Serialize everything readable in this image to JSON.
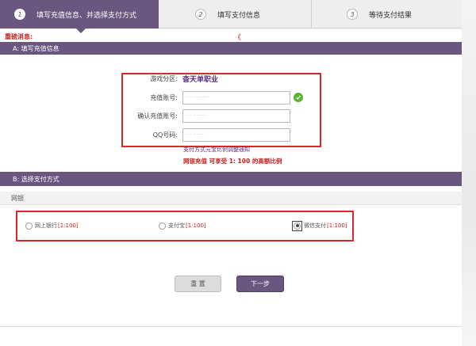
{
  "steps": [
    {
      "num": "1",
      "label": "填写充值信息、并选择支付方式"
    },
    {
      "num": "2",
      "label": "填写支付信息"
    },
    {
      "num": "3",
      "label": "等待支付结果"
    }
  ],
  "notice": {
    "label": "重磅消息:",
    "mark": "《"
  },
  "section_a": {
    "title": "A: 填写充值信息"
  },
  "form": {
    "server_label": "游戏分区:",
    "server_value": "杳天单职业",
    "account_label": "充值账号:",
    "account_value": "· ··· ·········",
    "confirm_label": "确认充值账号:",
    "confirm_value": "·  ··  ·········",
    "qq_label": "QQ号码:",
    "qq_value": "·  ··  ·······"
  },
  "hint": "支付方式元宝比例调整通知",
  "rate_note": "网银充值  可享受  1: 100  的高额比例",
  "section_b": {
    "title": "B: 选择支付方式"
  },
  "bank_strip": "网银",
  "payment_options": [
    {
      "name": "网上银行",
      "rate": "[1:100]"
    },
    {
      "name": "支付宝",
      "rate": "[1:100]"
    },
    {
      "name": "微信支付",
      "rate": "[1:100]"
    }
  ],
  "buttons": {
    "reset": "重 置",
    "next": "下一步"
  },
  "colors": {
    "brand": "#6b5680",
    "alert": "#c9201c",
    "highlight_box": "#d62a2a",
    "ok": "#5db430"
  }
}
